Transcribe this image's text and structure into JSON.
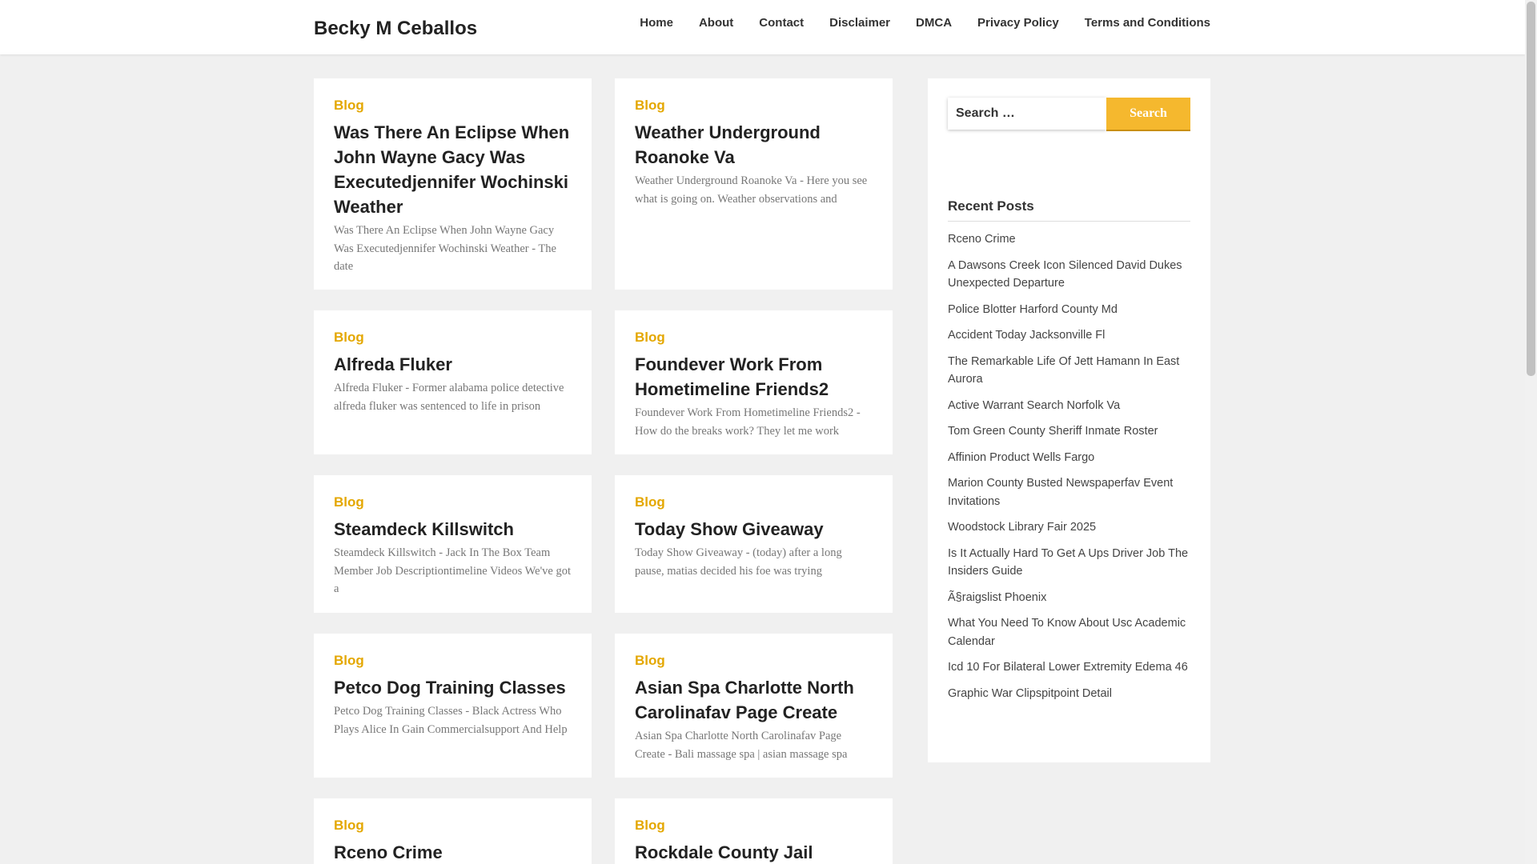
{
  "site": {
    "title": "Becky M Ceballos"
  },
  "nav": [
    "Home",
    "About",
    "Contact",
    "Disclaimer",
    "DMCA",
    "Privacy Policy",
    "Terms and Conditions"
  ],
  "posts": [
    {
      "category": "Blog",
      "title": "Was There An Eclipse When John Wayne Gacy Was Executedjennifer Wochinski Weather",
      "excerpt": "Was There An Eclipse When John Wayne Gacy Was Executedjennifer Wochinski Weather - The date"
    },
    {
      "category": "Blog",
      "title": "Weather Underground Roanoke Va",
      "excerpt": "Weather Underground Roanoke Va - Here you see what is going on. Weather observations and"
    },
    {
      "category": "Blog",
      "title": "Alfreda Fluker",
      "excerpt": "Alfreda Fluker - Former alabama police detective alfreda fluker was sentenced to life in prison"
    },
    {
      "category": "Blog",
      "title": "Foundever Work From Hometimeline Friends2",
      "excerpt": "Foundever Work From Hometimeline Friends2 - How do the breaks work? They let me work"
    },
    {
      "category": "Blog",
      "title": "Steamdeck Killswitch",
      "excerpt": "Steamdeck Killswitch - Jack In The Box Team Member Job Descriptiontimeline Videos We've got a"
    },
    {
      "category": "Blog",
      "title": "Today Show Giveaway",
      "excerpt": "Today Show Giveaway - (today) after a long pause, matias decided his foe was trying"
    },
    {
      "category": "Blog",
      "title": "Petco Dog Training Classes",
      "excerpt": "Petco Dog Training Classes - Black Actress Who Plays Alice In Gain Commercialsupport And Help"
    },
    {
      "category": "Blog",
      "title": "Asian Spa Charlotte North Carolinafav Page Create",
      "excerpt": "Asian Spa Charlotte North Carolinafav Page Create - Bali massage spa | asian massage spa"
    },
    {
      "category": "Blog",
      "title": "Rceno Crime",
      "excerpt": ""
    },
    {
      "category": "Blog",
      "title": "Rockdale County Jail",
      "excerpt": ""
    }
  ],
  "sidebar": {
    "search": {
      "placeholder": "Search …",
      "button": "Search"
    },
    "recent_title": "Recent Posts",
    "recent": [
      "Rceno Crime",
      "A Dawsons Creek Icon Silenced David Dukes Unexpected Departure",
      "Police Blotter Harford County Md",
      "Accident Today Jacksonville Fl",
      "The Remarkable Life Of Jett Hamann In East Aurora",
      "Active Warrant Search Norfolk Va",
      "Tom Green County Sheriff Inmate Roster",
      "Affinion Product Wells Fargo",
      "Marion County Busted Newspaperfav Event Invitations",
      "Woodstock Library Fair 2025",
      "Is It Actually Hard To Get A Ups Driver Job The Insiders Guide",
      "Ã§raigslist Phoenix",
      "What You Need To Know About Usc Academic Calendar",
      "Icd 10 For Bilateral Lower Extremity Edema 46",
      "Graphic War Clipspitpoint Detail"
    ]
  }
}
